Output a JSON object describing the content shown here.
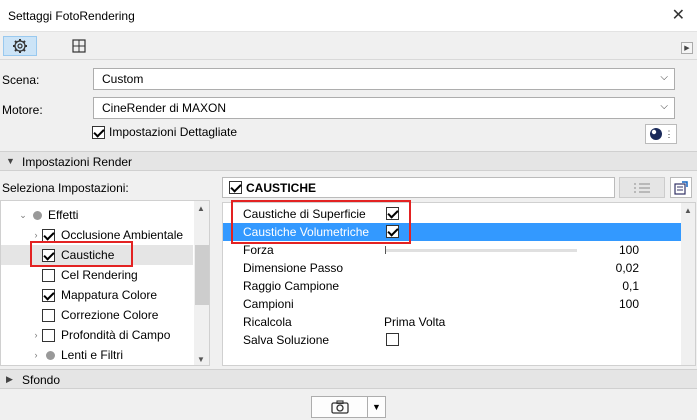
{
  "window": {
    "title": "Settaggi FotoRendering"
  },
  "scene": {
    "label": "Scena:",
    "value": "Custom"
  },
  "engine": {
    "label": "Motore:",
    "value": "CineRender di MAXON"
  },
  "detailed": {
    "label": "Impostazioni Dettagliate",
    "checked": true
  },
  "render_section": {
    "label": "Impostazioni Render"
  },
  "select_label": "Seleziona Impostazioni:",
  "tree": {
    "items": [
      {
        "label": "Effetti",
        "type": "group",
        "checked": null
      },
      {
        "label": "Occlusione Ambientale",
        "checked": true
      },
      {
        "label": "Caustiche",
        "checked": true,
        "selected": true
      },
      {
        "label": "Cel Rendering",
        "checked": false
      },
      {
        "label": "Mappatura Colore",
        "checked": true
      },
      {
        "label": "Correzione Colore",
        "checked": false
      },
      {
        "label": "Profondità di Campo",
        "checked": false
      },
      {
        "label": "Lenti e Filtri",
        "type": "group"
      }
    ]
  },
  "effect": {
    "title": "CAUSTICHE",
    "checked": true
  },
  "props": {
    "rows": [
      {
        "name": "Caustiche di Superficie",
        "checkbox": true,
        "checked": true
      },
      {
        "name": "Caustiche Volumetriche",
        "checkbox": true,
        "checked": true,
        "selected": true
      },
      {
        "name": "Forza",
        "slider": true,
        "number": "100",
        "slider_fraction": 0
      },
      {
        "name": "Dimensione Passo",
        "number": "0,02"
      },
      {
        "name": "Raggio Campione",
        "number": "0,1"
      },
      {
        "name": "Campioni",
        "number": "100"
      },
      {
        "name": "Ricalcola",
        "value": "Prima Volta"
      },
      {
        "name": "Salva Soluzione",
        "checkbox": true,
        "checked": false
      }
    ]
  },
  "background_section": {
    "label": "Sfondo"
  },
  "colors": {
    "selection_blue": "#3399ff",
    "highlight_red": "#e32222",
    "tab_active": "#cce4f7"
  }
}
